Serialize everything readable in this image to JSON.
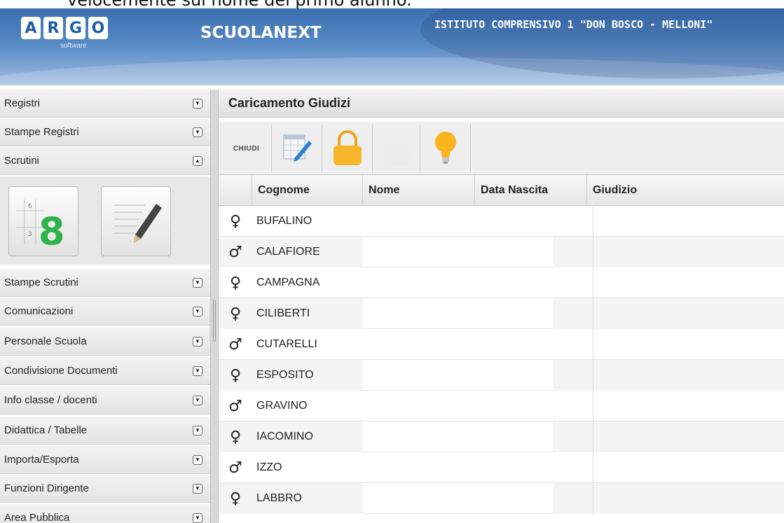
{
  "doc_caption": "velocemente sul nome del primo alunno.",
  "header": {
    "logo_letters": [
      "A",
      "R",
      "G",
      "O"
    ],
    "logo_sub": "software",
    "brand": "SCUOLANEXT",
    "school": "ISTITUTO COMPRENSIVO 1 \"DON BOSCO - MELLONI\""
  },
  "sidebar": {
    "items": [
      {
        "label": "Registri"
      },
      {
        "label": "Stampe Registri"
      },
      {
        "label": "Scrutini"
      },
      {
        "label": "Stampe Scrutini"
      },
      {
        "label": "Comunicazioni"
      },
      {
        "label": "Personale Scuola"
      },
      {
        "label": "Condivisione Documenti"
      },
      {
        "label": "Info classe / docenti"
      },
      {
        "label": "Didattica / Tabelle"
      },
      {
        "label": "Importa/Esporta"
      },
      {
        "label": "Funzioni Dirigente"
      },
      {
        "label": "Area Pubblica"
      }
    ]
  },
  "main": {
    "title": "Caricamento Giudizi",
    "toolbar": {
      "close_label": "CHIUDI"
    },
    "grid": {
      "columns": [
        "Cognome",
        "Nome",
        "Data Nascita",
        "Giudizio"
      ],
      "rows": [
        {
          "sex": "♀",
          "cognome": "BUFALINO"
        },
        {
          "sex": "♂",
          "cognome": "CALAFIORE"
        },
        {
          "sex": "♀",
          "cognome": "CAMPAGNA"
        },
        {
          "sex": "♀",
          "cognome": "CILIBERTI"
        },
        {
          "sex": "♂",
          "cognome": "CUTARELLI"
        },
        {
          "sex": "♀",
          "cognome": "ESPOSITO"
        },
        {
          "sex": "♂",
          "cognome": "GRAVINO"
        },
        {
          "sex": "♀",
          "cognome": "IACOMINO"
        },
        {
          "sex": "♂",
          "cognome": "IZZO"
        },
        {
          "sex": "♀",
          "cognome": "LABBRO"
        }
      ]
    }
  },
  "colors": {
    "female": "#e0466a",
    "male": "#2b7fc2",
    "accent": "#3a6fb0"
  }
}
